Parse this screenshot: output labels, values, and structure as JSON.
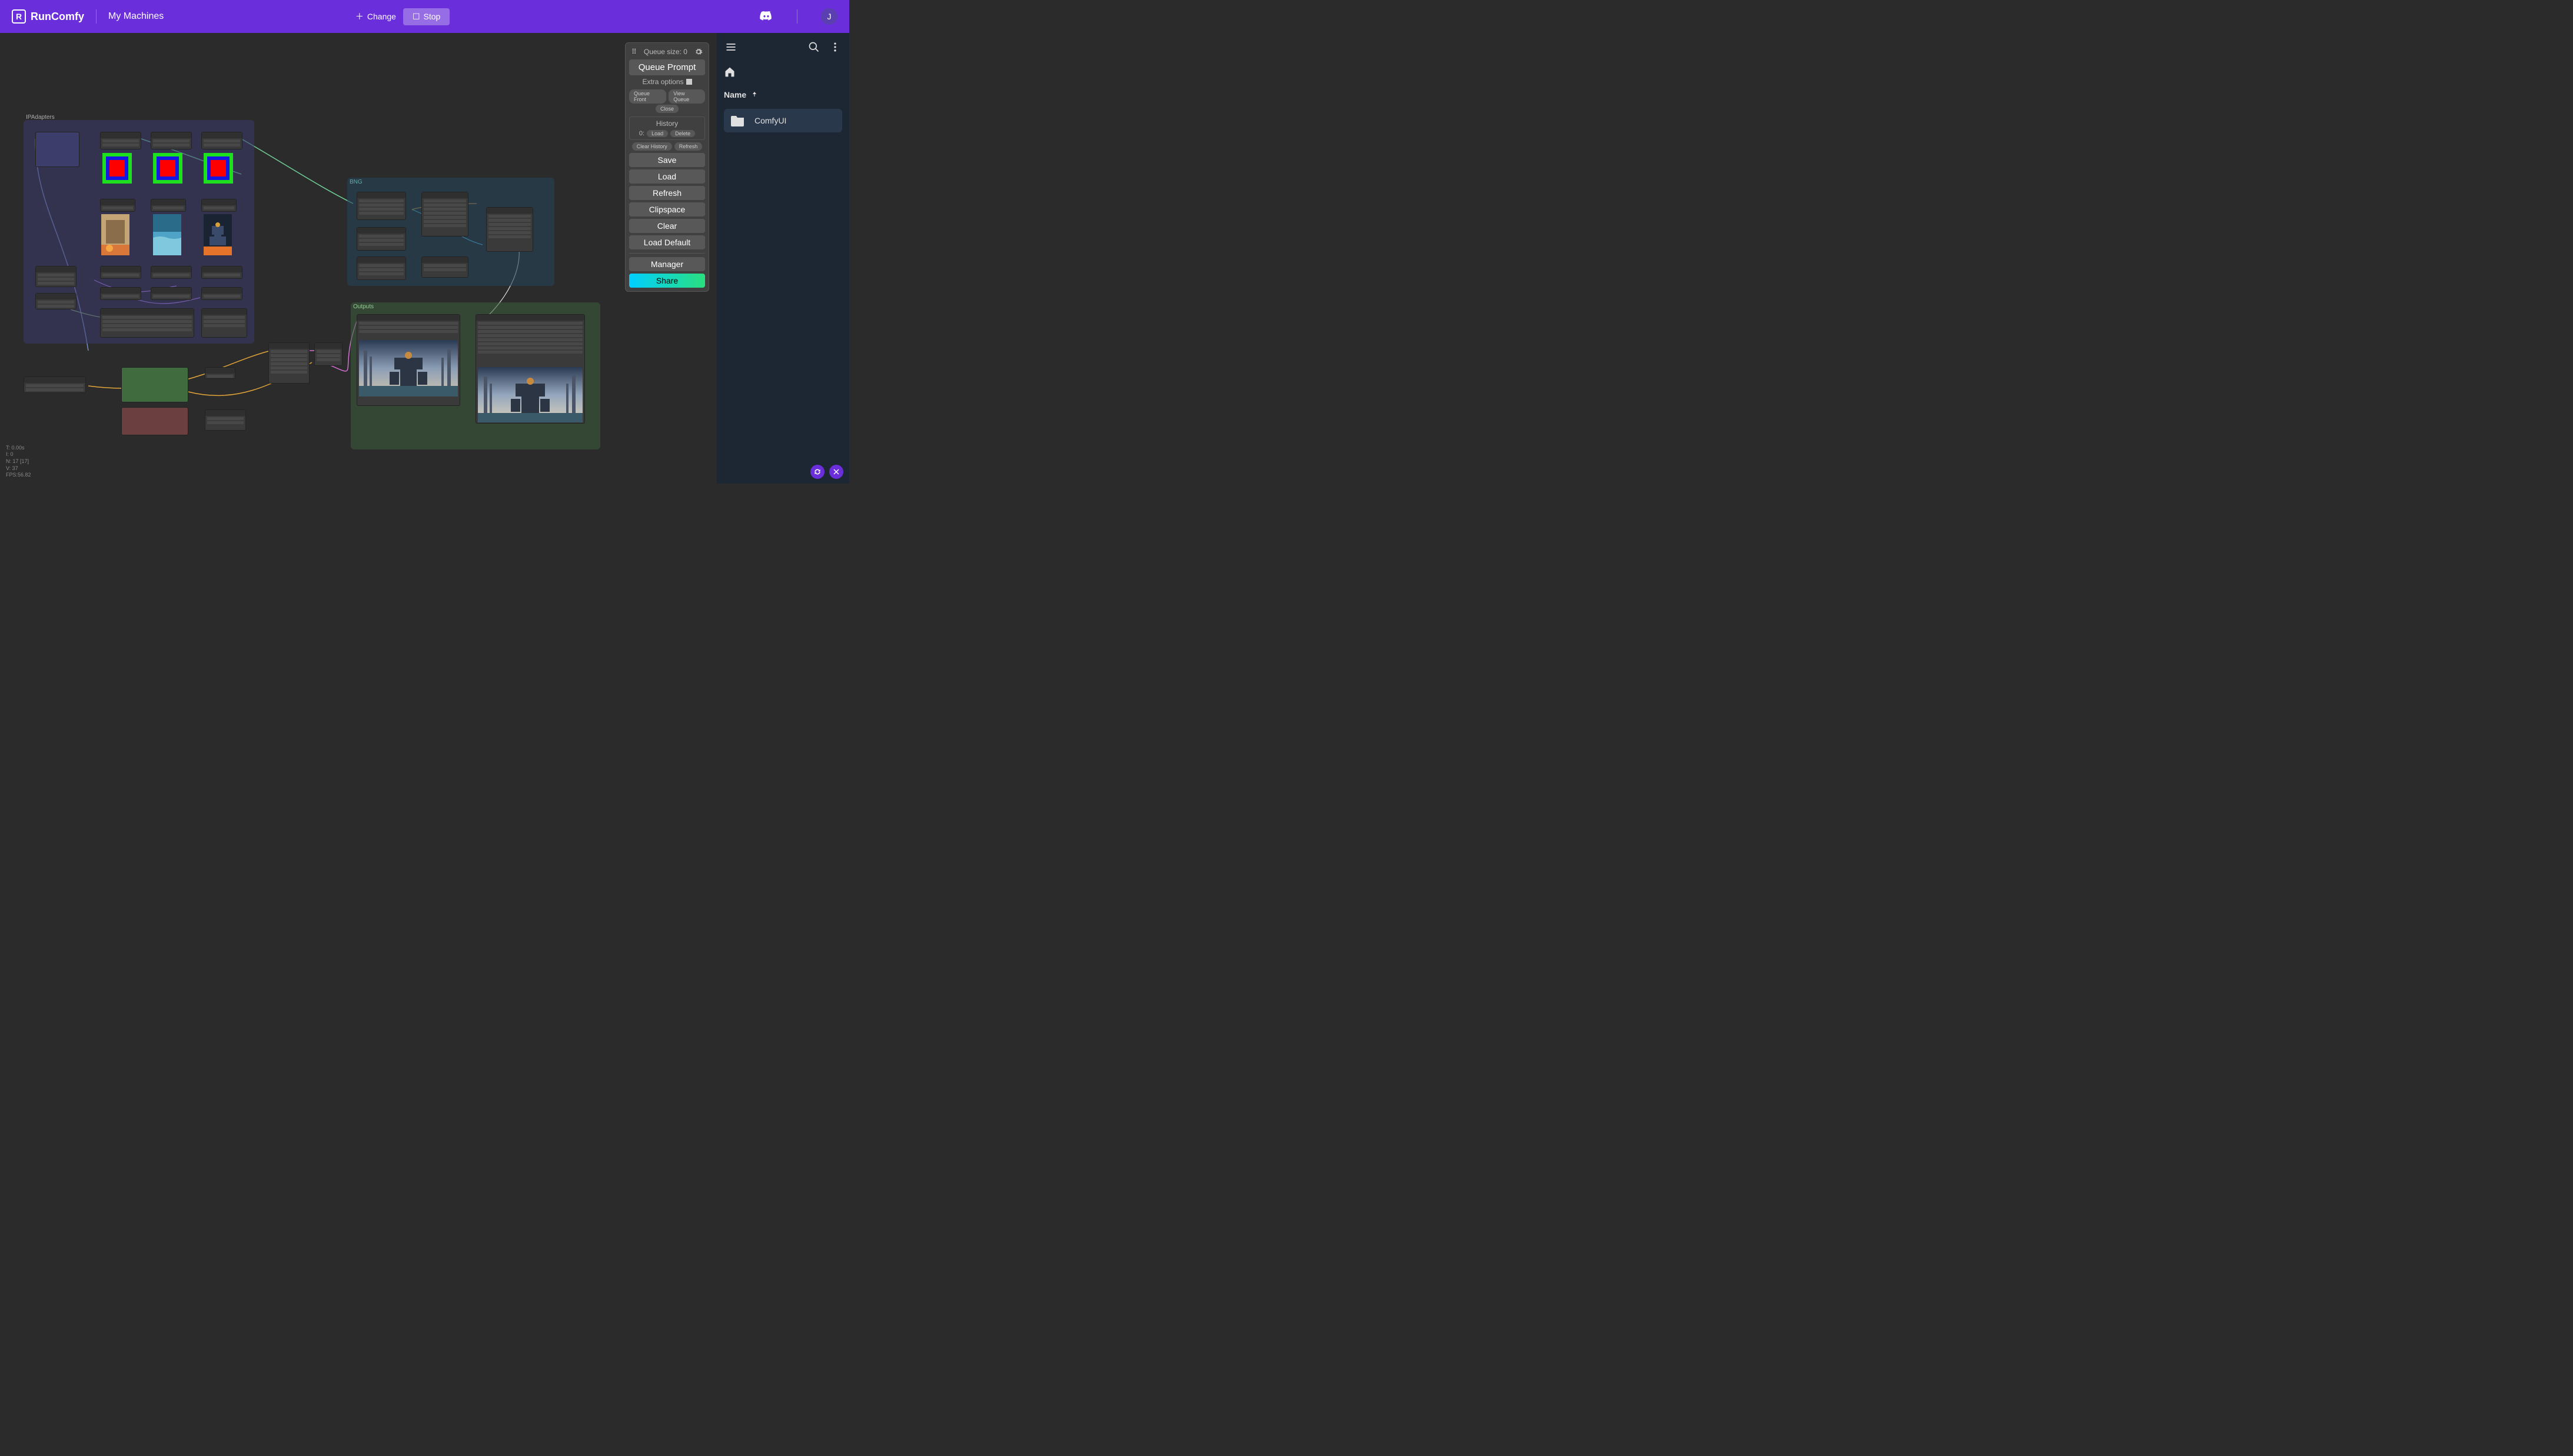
{
  "topbar": {
    "brand": "RunComfy",
    "nav_label": "My Machines",
    "change_label": "Change",
    "stop_label": "Stop",
    "user_initial": "J"
  },
  "panel": {
    "queue_label": "Queue size: 0",
    "queue_prompt": "Queue Prompt",
    "extra_options": "Extra options",
    "queue_front": "Queue Front",
    "view_queue": "View Queue",
    "close": "Close",
    "history_title": "History",
    "history_index": "0:",
    "load_small": "Load",
    "delete_small": "Delete",
    "clear_history": "Clear History",
    "refresh_small": "Refresh",
    "save": "Save",
    "load": "Load",
    "refresh": "Refresh",
    "clipspace": "Clipspace",
    "clear": "Clear",
    "load_default": "Load Default",
    "manager": "Manager",
    "share": "Share"
  },
  "filebrowser": {
    "name_header": "Name",
    "items": [
      {
        "label": "ComfyUI"
      }
    ]
  },
  "groups": {
    "ipadapters_label": "IPAdapters",
    "bng_label": "BNG",
    "outputs_label": "Outputs"
  },
  "stats": {
    "t": "T: 0.00s",
    "i": "I: 0",
    "n": "N: 17 [17]",
    "v": "V: 37",
    "fps": "FPS:56.82"
  }
}
